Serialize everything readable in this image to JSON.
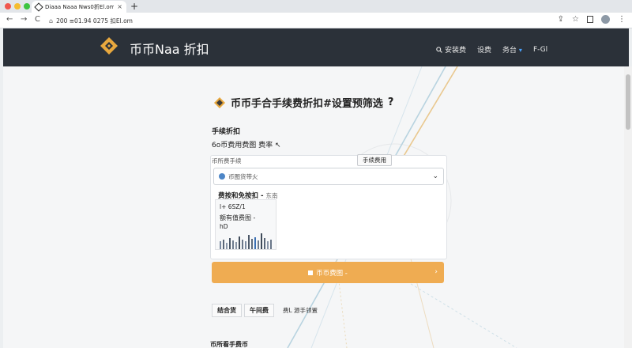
{
  "browser": {
    "tab_title": "Diaaa Naaa Nws0折El.om",
    "tab_close": "×",
    "new_tab": "+",
    "url": "200 ≡01.94 0275 扣El.om",
    "nav_back": "←",
    "nav_forward": "→",
    "nav_reload": "C",
    "lock": "⌂",
    "share": "⇪",
    "star": "☆",
    "more": "⋮"
  },
  "header": {
    "brand": "币币Naa 折扣",
    "nav": {
      "search_label": "安装费",
      "item_1": "设费",
      "item_2": "务台",
      "item_3": "F-Gl"
    }
  },
  "card": {
    "title": "币币手合手续费折扣#设置预筛选",
    "help": "?",
    "fee_label": "手续折扣",
    "fee_line": "6o币费用费图 费率",
    "fee_line_arrow": "↖",
    "select_label": "币所费手续",
    "fee_tag": "手续费用",
    "select_value": "币图货带火",
    "info_head": "费按和免按扣 -",
    "info_head_sub": "东南",
    "mini_l1": "l+ 6SZ/1",
    "mini_l2": "额有值费图 -",
    "mini_l3": "hD",
    "cta_label": "币币费图 -",
    "cta_arrow": "›",
    "toggle_1": "结合货",
    "toggle_2": "午间费",
    "toggle_desc": "费L 源手领置",
    "footer_label": "币所看手费币"
  },
  "colors": {
    "header_bg": "#2b3139",
    "accent": "#efac52",
    "logo": "#e8a83e"
  },
  "icons": {
    "logo": "diamond-logo-icon",
    "search": "search-icon",
    "chevron": "chevron-down-icon",
    "select": "coin-icon"
  }
}
